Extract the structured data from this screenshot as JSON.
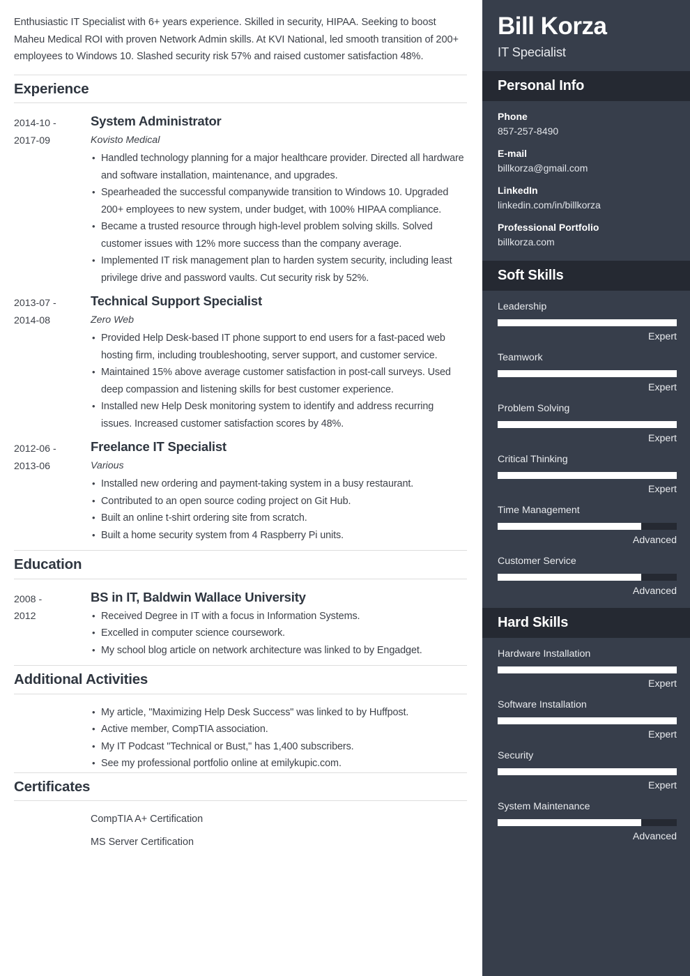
{
  "summary": "Enthusiastic IT Specialist with 6+ years experience. Skilled in security, HIPAA. Seeking to boost Maheu Medical ROI with proven Network Admin skills. At KVI National, led smooth transition of 200+ employees to Windows 10. Slashed security risk 57% and raised customer satisfaction 48%.",
  "sections": {
    "experience_title": "Experience",
    "education_title": "Education",
    "activities_title": "Additional Activities",
    "certificates_title": "Certificates"
  },
  "experience": [
    {
      "dates": "2014-10 - 2017-09",
      "title": "System Administrator",
      "org": "Kovisto Medical",
      "bullets": [
        "Handled technology planning for a major healthcare provider. Directed all hardware and software installation, maintenance, and upgrades.",
        "Spearheaded the successful companywide transition to Windows 10. Upgraded 200+ employees to new system, under budget, with 100% HIPAA compliance.",
        "Became a trusted resource through high-level problem solving skills. Solved customer issues with 12% more success than the company average.",
        "Implemented IT risk management plan to harden system security, including least privilege drive and password vaults. Cut security risk by 52%."
      ]
    },
    {
      "dates": "2013-07 - 2014-08",
      "title": "Technical Support Specialist",
      "org": "Zero Web",
      "bullets": [
        "Provided Help Desk-based IT phone support to end users for a fast-paced web hosting firm, including troubleshooting, server support, and customer service.",
        "Maintained 15% above average customer satisfaction in post-call surveys. Used deep compassion and listening skills for best customer experience.",
        "Installed new Help Desk monitoring system to identify and address recurring issues. Increased customer satisfaction scores by 48%."
      ]
    },
    {
      "dates": "2012-06 - 2013-06",
      "title": "Freelance IT Specialist",
      "org": "Various",
      "bullets": [
        "Installed new ordering and payment-taking system in a busy restaurant.",
        "Contributed to an open source coding project on Git Hub.",
        "Built an online t-shirt ordering site from scratch.",
        "Built a home security system from 4 Raspberry Pi units."
      ]
    }
  ],
  "education": [
    {
      "dates": "2008 - 2012",
      "title": "BS in IT, Baldwin Wallace University",
      "bullets": [
        "Received Degree in IT with a focus in Information Systems.",
        "Excelled in computer science coursework.",
        "My school blog article on network architecture was linked to by Engadget."
      ]
    }
  ],
  "activities": [
    "My article, \"Maximizing Help Desk Success\" was linked to by Huffpost.",
    "Active member, CompTIA association.",
    "My IT Podcast \"Technical or Bust,\" has 1,400 subscribers.",
    "See my professional portfolio online at emilykupic.com."
  ],
  "certificates": [
    "CompTIA A+ Certification",
    "MS Server Certification"
  ],
  "sidebar": {
    "name": "Bill Korza",
    "role": "IT Specialist",
    "personal_info_title": "Personal Info",
    "personal_info": [
      {
        "label": "Phone",
        "value": "857-257-8490"
      },
      {
        "label": "E-mail",
        "value": "billkorza@gmail.com"
      },
      {
        "label": "LinkedIn",
        "value": "linkedin.com/in/billkorza"
      },
      {
        "label": "Professional Portfolio",
        "value": "billkorza.com"
      }
    ],
    "soft_skills_title": "Soft Skills",
    "soft_skills": [
      {
        "name": "Leadership",
        "level": "Expert",
        "percent": 100
      },
      {
        "name": "Teamwork",
        "level": "Expert",
        "percent": 100
      },
      {
        "name": "Problem Solving",
        "level": "Expert",
        "percent": 100
      },
      {
        "name": "Critical Thinking",
        "level": "Expert",
        "percent": 100
      },
      {
        "name": "Time Management",
        "level": "Advanced",
        "percent": 80
      },
      {
        "name": "Customer Service",
        "level": "Advanced",
        "percent": 80
      }
    ],
    "hard_skills_title": "Hard Skills",
    "hard_skills": [
      {
        "name": "Hardware Installation",
        "level": "Expert",
        "percent": 100
      },
      {
        "name": "Software Installation",
        "level": "Expert",
        "percent": 100
      },
      {
        "name": "Security",
        "level": "Expert",
        "percent": 100
      },
      {
        "name": "System Maintenance",
        "level": "Advanced",
        "percent": 80
      }
    ]
  },
  "colors": {
    "sidebar_bg": "#373e4b",
    "sidebar_header_bg": "#252932",
    "bar_fill": "#ffffff",
    "text_dark": "#3d4149"
  }
}
